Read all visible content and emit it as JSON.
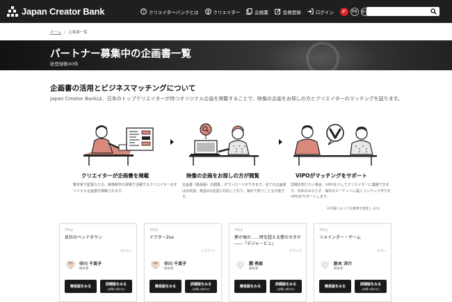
{
  "header": {
    "logo_text": "Japan Creator Bank",
    "nav": [
      {
        "label": "クリエイターバンクとは",
        "icon": "question-circle-icon"
      },
      {
        "label": "クリエイター",
        "icon": "person-icon"
      },
      {
        "label": "企画書",
        "icon": "document-icon"
      },
      {
        "label": "会員登録",
        "icon": "edit-icon"
      },
      {
        "label": "ログイン",
        "icon": "login-icon"
      }
    ],
    "languages": [
      "JP",
      "EN",
      "中文"
    ],
    "active_language": "JP",
    "search_placeholder": "",
    "accent_color": "#d22222"
  },
  "breadcrumb": {
    "home": "ホーム",
    "current": "企画書一覧"
  },
  "hero": {
    "title": "パートナー募集中の企画書一覧",
    "count": "総登録数40件"
  },
  "about": {
    "title": "企画書の活用とビジネスマッチングについて",
    "description": "Japan Creator Bankは、日本のトップクリエイターが持つオリジナル企画を掲載することで、映像の企画をお探しの方とクリエイターのマッチングを図ります。",
    "steps": [
      {
        "title": "クリエイターが企画書を掲載",
        "desc": "脚本家や監督などの、映像制作の現場で活躍するクリエイターのオリジナル企画書が掲載されます。"
      },
      {
        "title": "映像の企画をお探しの方が閲覧",
        "desc": "企画書（簡易版）の閲覧、ダウンロードができます。全ての企画書は日本語、英語の2言語に対応しており、海外で使うことも可能です。"
      },
      {
        "title": "VIPOがマッチングをサポート",
        "desc": "詳細を知りたい場合、VIPOを介してクリエイターに連絡できます。日本のみならず、海外のマーケットに届くコンテンツ作りをVIPOがサポートします。"
      }
    ],
    "note": "※内容によっては費用が発生します。"
  },
  "cards": [
    {
      "label": "TITLE",
      "title": "反社のベッドタウン",
      "genre": "コメディ",
      "person": "中川 千英子",
      "role": "脚本家",
      "btn_simple": "簡易版をみる",
      "btn_detail": "詳細版をみる",
      "btn_detail_sub": "(お問い合わせ)"
    },
    {
      "label": "TITLE",
      "title": "ドクターZoo",
      "genre": "ミステリー",
      "person": "中川 千英子",
      "role": "脚本家",
      "btn_simple": "簡易版をみる",
      "btn_detail": "詳細版をみる",
      "btn_detail_sub": "(お問い合わせ)"
    },
    {
      "label": "TITLE",
      "title": "夢か現か……時を超える愛のカタチ――「デジャ・ビュ」",
      "genre": "ロマンス",
      "person": "関 秀郎",
      "role": "脚本家",
      "btn_simple": "簡易版をみる",
      "btn_detail": "詳細版をみる",
      "btn_detail_sub": "(お問い合わせ)"
    },
    {
      "label": "TITLE",
      "title": "リメインダー・ゲーム",
      "genre": "ホラー",
      "person": "鈴木 洋介",
      "role": "脚本家",
      "btn_simple": "簡易版をみる",
      "btn_detail": "詳細版をみる",
      "btn_detail_sub": "(お問い合わせ)"
    }
  ]
}
